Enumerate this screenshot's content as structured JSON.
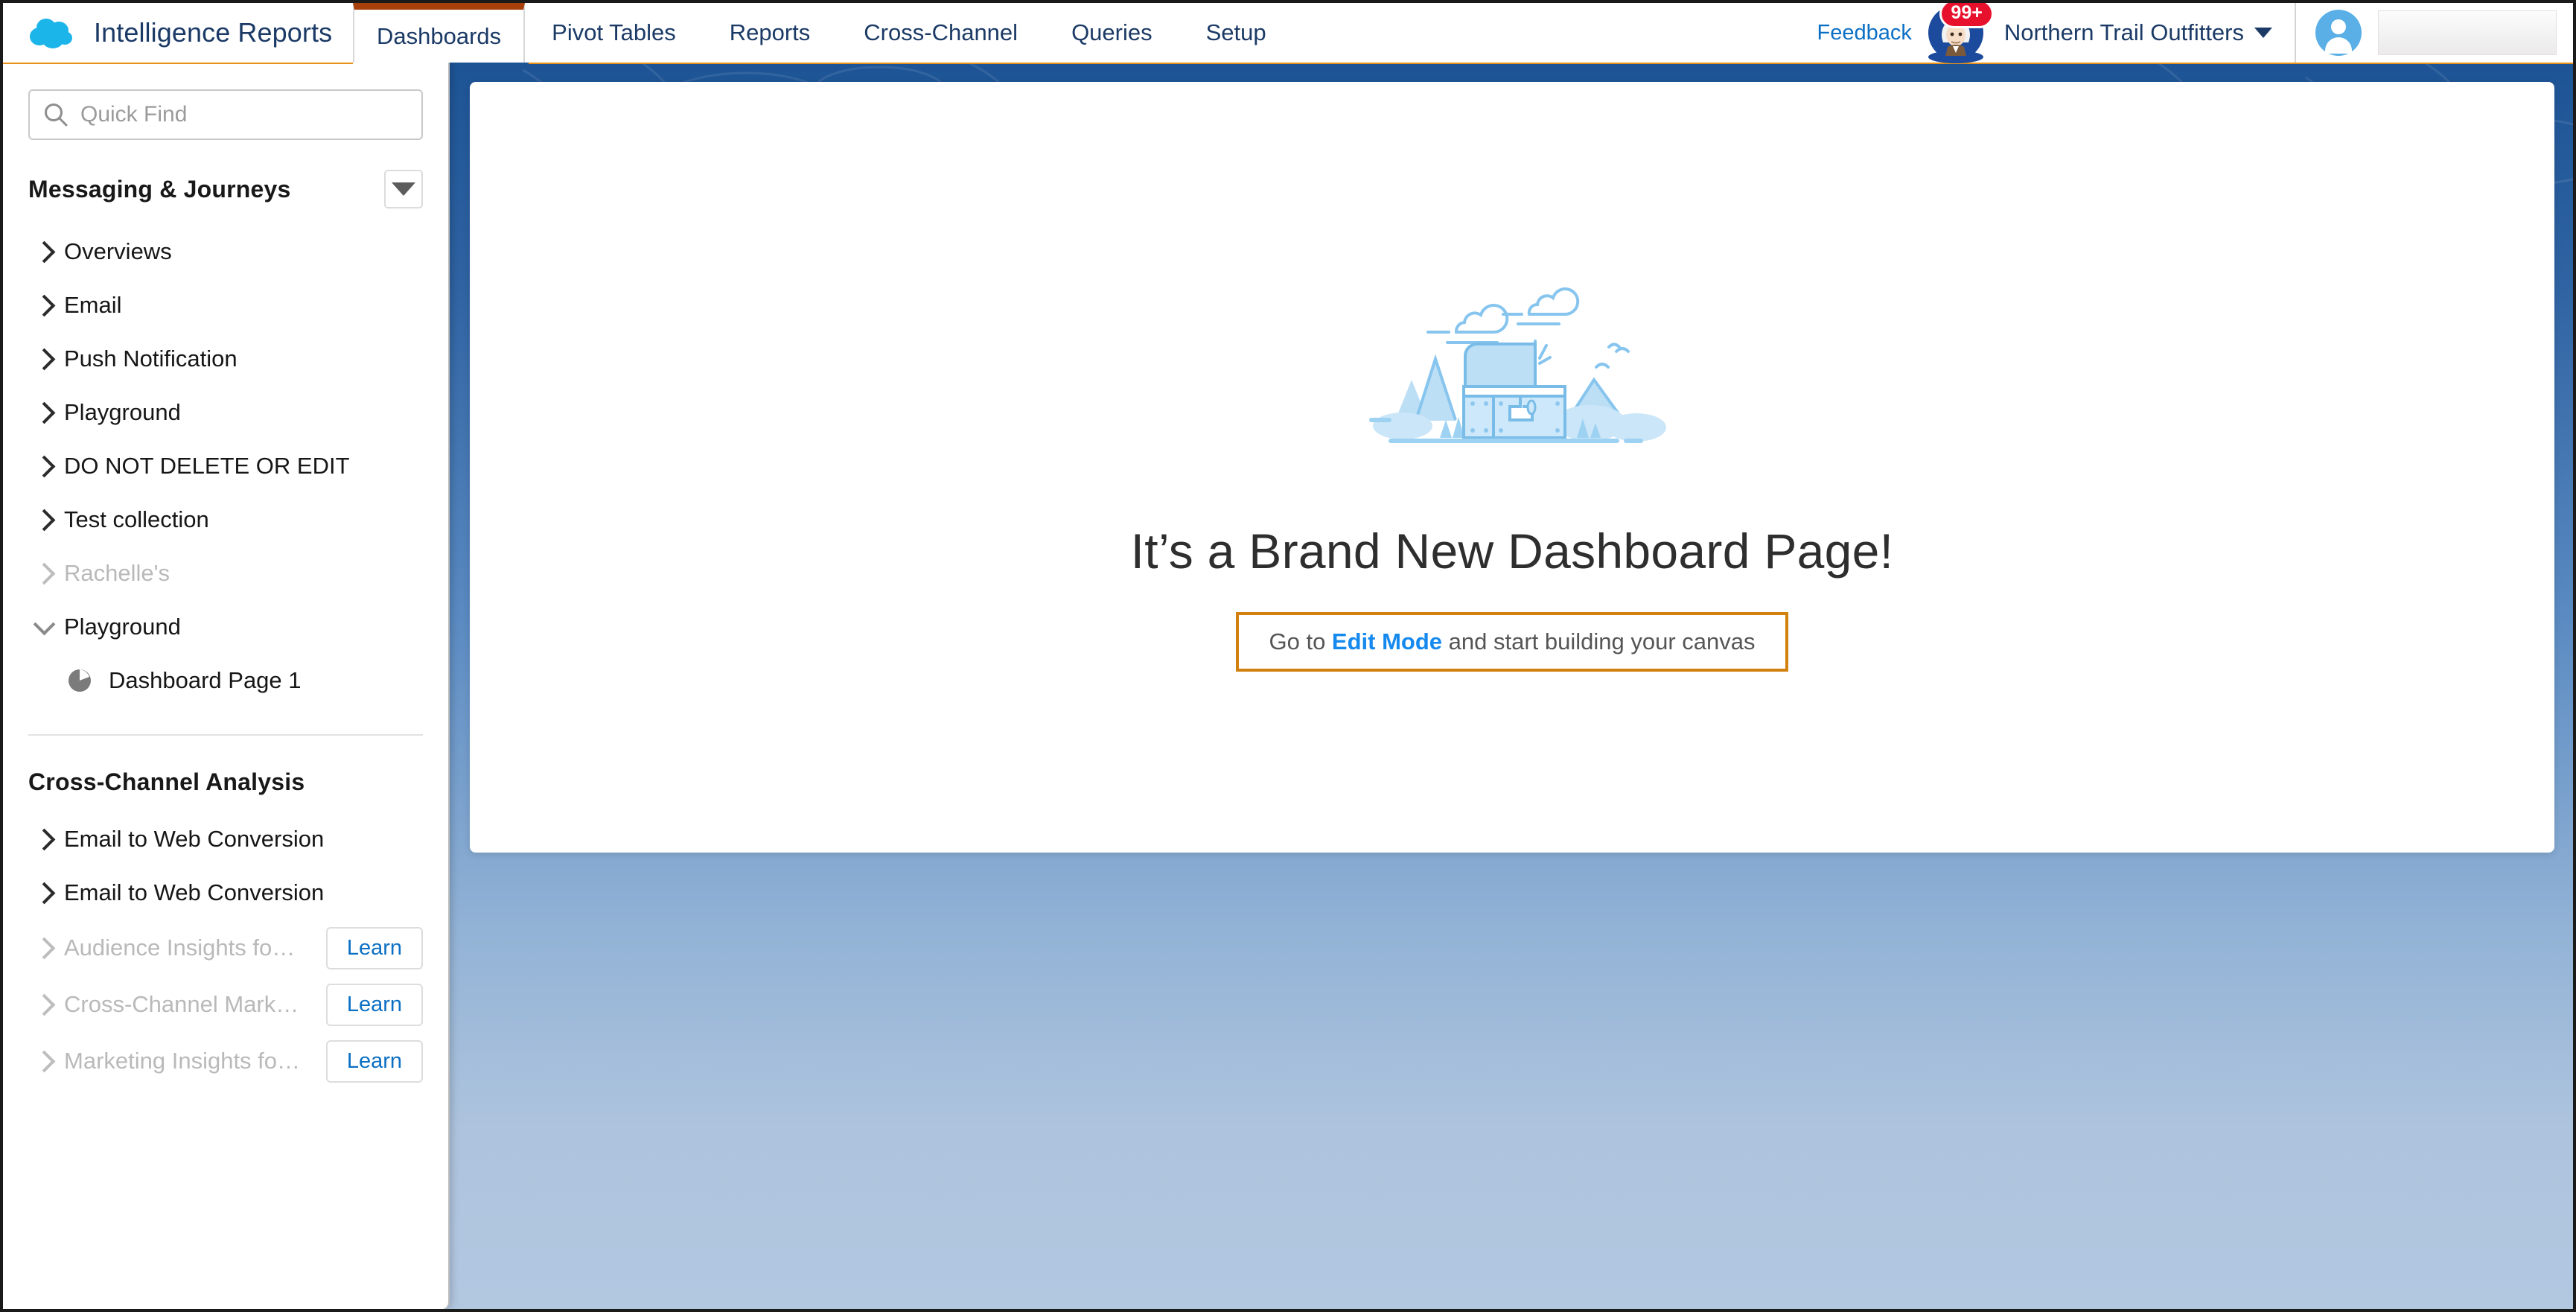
{
  "header": {
    "brand_title": "Intelligence Reports",
    "brand_logo_icon": "salesforce-cloud-logo",
    "tabs": [
      {
        "label": "Dashboards",
        "active": true
      },
      {
        "label": "Pivot Tables",
        "active": false
      },
      {
        "label": "Reports",
        "active": false
      },
      {
        "label": "Cross-Channel",
        "active": false
      },
      {
        "label": "Queries",
        "active": false
      },
      {
        "label": "Setup",
        "active": false
      }
    ],
    "feedback_label": "Feedback",
    "notification_badge": "99+",
    "assistant_icon": "einstein-assistant-icon",
    "org_name": "Northern Trail Outfitters",
    "org_caret_icon": "chevron-down-icon",
    "user_avatar_icon": "user-avatar-icon",
    "accent_orange": "#e8921a",
    "active_tab_accent": "#a8400c",
    "link_blue": "#0b6fc4"
  },
  "sidebar": {
    "search": {
      "placeholder": "Quick Find",
      "value": "",
      "icon": "search-icon"
    },
    "sections": [
      {
        "title": "Messaging & Journeys",
        "menu_icon": "caret-down-icon",
        "items": [
          {
            "label": "Overviews",
            "state": "collapsed",
            "icon": "chevron-right-icon"
          },
          {
            "label": "Email",
            "state": "collapsed",
            "icon": "chevron-right-icon"
          },
          {
            "label": "Push Notification",
            "state": "collapsed",
            "icon": "chevron-right-icon"
          },
          {
            "label": "Playground",
            "state": "collapsed",
            "icon": "chevron-right-icon"
          },
          {
            "label": "DO NOT DELETE OR EDIT",
            "state": "collapsed",
            "icon": "chevron-right-icon"
          },
          {
            "label": "Test collection",
            "state": "collapsed",
            "icon": "chevron-right-icon"
          },
          {
            "label": "Rachelle's",
            "state": "collapsed-muted",
            "icon": "chevron-right-icon"
          },
          {
            "label": "Playground",
            "state": "expanded",
            "icon": "chevron-down-icon"
          }
        ],
        "children": [
          {
            "label": "Dashboard Page 1",
            "icon": "pie-chart-icon",
            "parent": "Playground"
          }
        ]
      },
      {
        "title": "Cross-Channel Analysis",
        "items": [
          {
            "label": "Email to Web Conversion",
            "state": "collapsed",
            "icon": "chevron-right-icon",
            "action": null
          },
          {
            "label": "Email to Web Conversion",
            "state": "collapsed",
            "icon": "chevron-right-icon",
            "action": null
          },
          {
            "label": "Audience Insights for Adv...",
            "state": "collapsed-muted",
            "icon": "chevron-right-icon",
            "action": "Learn"
          },
          {
            "label": "Cross-Channel Marketing ...",
            "state": "collapsed-muted",
            "icon": "chevron-right-icon",
            "action": "Learn"
          },
          {
            "label": "Marketing Insights for Sal...",
            "state": "collapsed-muted",
            "icon": "chevron-right-icon",
            "action": "Learn"
          }
        ]
      }
    ]
  },
  "main": {
    "illustration_icon": "treasure-chest-illustration",
    "title": "It’s a Brand New Dashboard Page!",
    "hint_prefix": "Go to ",
    "hint_link": "Edit Mode",
    "hint_suffix": " and start building your canvas",
    "hint_border_color": "#d2800f"
  }
}
